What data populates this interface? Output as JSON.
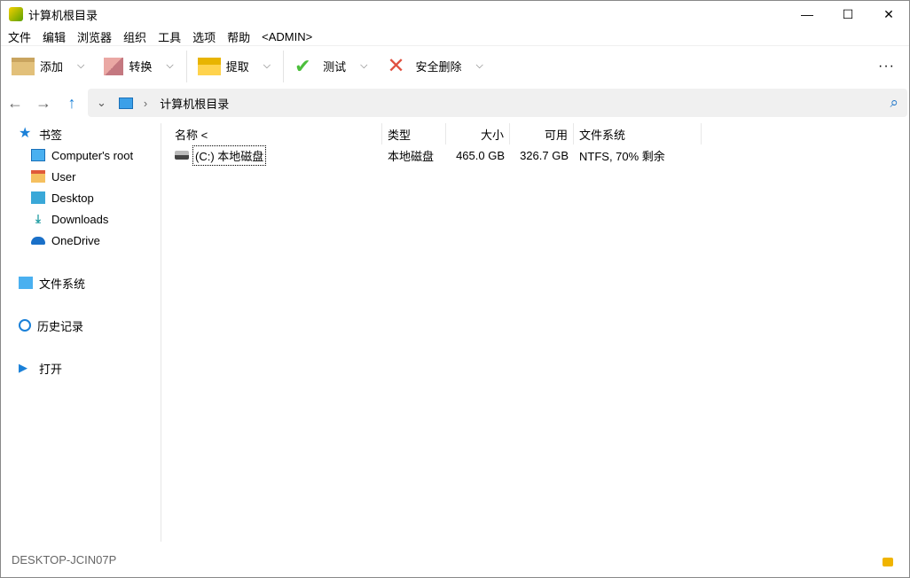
{
  "window": {
    "title": "计算机根目录",
    "min": "—",
    "max": "☐",
    "close": "✕"
  },
  "menu": [
    "文件",
    "编辑",
    "浏览器",
    "组织",
    "工具",
    "选项",
    "帮助",
    "<ADMIN>"
  ],
  "toolbar": {
    "add": "添加",
    "convert": "转换",
    "extract": "提取",
    "test": "测试",
    "secure_delete": "安全删除",
    "more": "···"
  },
  "nav": {
    "back": "←",
    "forward": "→",
    "up": "↑",
    "dropdown": "⌄",
    "sep": "›",
    "path": "计算机根目录",
    "search": "⌕"
  },
  "sidebar": {
    "bookmarks": "书签",
    "items": [
      "Computer's root",
      "User",
      "Desktop",
      "Downloads",
      "OneDrive"
    ],
    "filesystem": "文件系统",
    "history": "历史记录",
    "open": "打开"
  },
  "columns": {
    "name": "名称 <",
    "type": "类型",
    "size": "大小",
    "free": "可用",
    "fs": "文件系统"
  },
  "rows": [
    {
      "name": "(C:) 本地磁盘",
      "type": "本地磁盘",
      "size": "465.0 GB",
      "free": "326.7 GB",
      "fs": "NTFS, 70% 剩余"
    }
  ],
  "status": {
    "host": "DESKTOP-JCIN07P"
  }
}
